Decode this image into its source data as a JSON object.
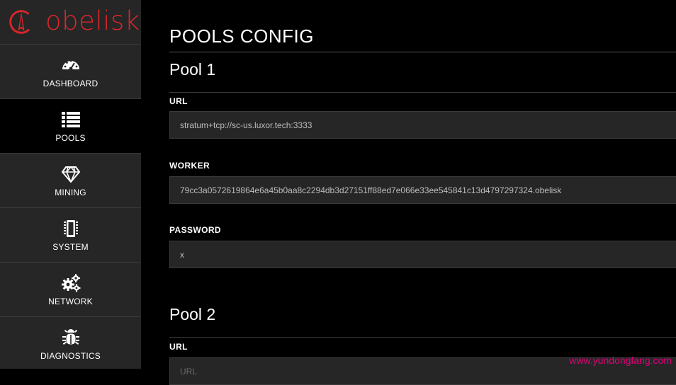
{
  "brand": {
    "name": "obelisk",
    "accent": "#d9262b"
  },
  "sidebar": {
    "items": [
      {
        "label": "DASHBOARD",
        "icon": "dashboard-gauge-icon",
        "active": false
      },
      {
        "label": "POOLS",
        "icon": "list-icon",
        "active": true
      },
      {
        "label": "MINING",
        "icon": "diamond-icon",
        "active": false
      },
      {
        "label": "SYSTEM",
        "icon": "chip-icon",
        "active": false
      },
      {
        "label": "NETWORK",
        "icon": "gears-icon",
        "active": false
      },
      {
        "label": "DIAGNOSTICS",
        "icon": "bug-icon",
        "active": false
      }
    ]
  },
  "main": {
    "title": "POOLS CONFIG",
    "pools": [
      {
        "title": "Pool 1",
        "url_label": "URL",
        "url_value": "stratum+tcp://sc-us.luxor.tech:3333",
        "worker_label": "WORKER",
        "worker_value": "79cc3a0572619864e6a45b0aa8c2294db3d27151ff88ed7e066e33ee545841c13d4797297324.obelisk",
        "password_label": "PASSWORD",
        "password_value": "x"
      },
      {
        "title": "Pool 2",
        "url_label": "URL",
        "url_value": "URL"
      }
    ]
  },
  "watermark": "www.yundongfang.com"
}
